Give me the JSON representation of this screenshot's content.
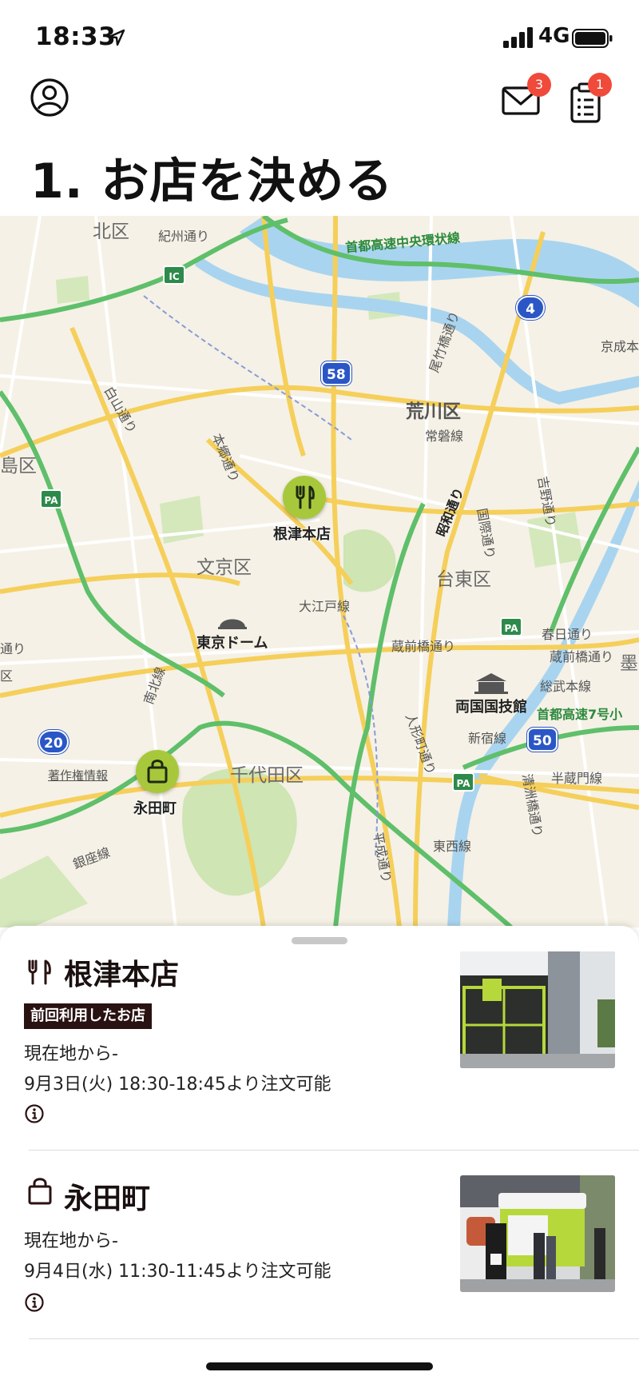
{
  "status_bar": {
    "time": "18:33",
    "network": "4G",
    "icons": [
      "location-arrow-icon",
      "signal-icon",
      "battery-icon"
    ]
  },
  "header": {
    "profile_icon": "person-circle-icon",
    "mail_icon": "envelope-icon",
    "mail_badge": "3",
    "tasks_icon": "clipboard-list-icon",
    "tasks_badge": "1",
    "title": "1. お店を決める"
  },
  "colors": {
    "accent_green": "#a8c83c",
    "badge_red": "#f04a3a",
    "tag_dark": "#2a1212",
    "route_blue": "#2a56c6"
  },
  "map": {
    "ward_labels": [
      "北区",
      "荒川区",
      "文京区",
      "台東区",
      "千代田区",
      "島区",
      "墨"
    ],
    "road_labels": [
      "紀州通り",
      "白山通り",
      "本郷通り",
      "尾竹橋通り",
      "常磐線",
      "昭和通り",
      "吉野通り",
      "国際通り",
      "大江戸線",
      "蔵前橋通り",
      "春日通り",
      "蔵前橋通り",
      "総武本線",
      "新宿線",
      "人形町通り",
      "半蔵門線",
      "清洲橋通り",
      "南北線",
      "東西線",
      "平成通り",
      "京成本",
      "通り",
      "区",
      "銀座線"
    ],
    "highway_labels": [
      "首都高速中央環状線",
      "首都高速7号小"
    ],
    "landmarks": [
      "東京ドーム",
      "両国国技館"
    ],
    "route_numbers": [
      "58",
      "4",
      "20",
      "50"
    ],
    "ic_label": "IC",
    "pa_label": "PA",
    "copyright": "著作権情報",
    "pins": [
      {
        "label": "根津本店",
        "icon": "fork-knife-icon"
      },
      {
        "label": "永田町",
        "icon": "shopping-bag-icon"
      }
    ]
  },
  "shops": [
    {
      "name": "根津本店",
      "icon": "fork-knife-icon",
      "tag": "前回利用したお店",
      "distance": "現在地から-",
      "availability": "9月3日(火) 18:30-18:45より注文可能",
      "info_icon": "info-icon",
      "photo": "storefront-photo"
    },
    {
      "name": "永田町",
      "icon": "shopping-bag-icon",
      "tag": "",
      "distance": "現在地から-",
      "availability": "9月4日(水) 11:30-11:45より注文可能",
      "info_icon": "info-icon",
      "photo": "food-truck-photo"
    }
  ]
}
